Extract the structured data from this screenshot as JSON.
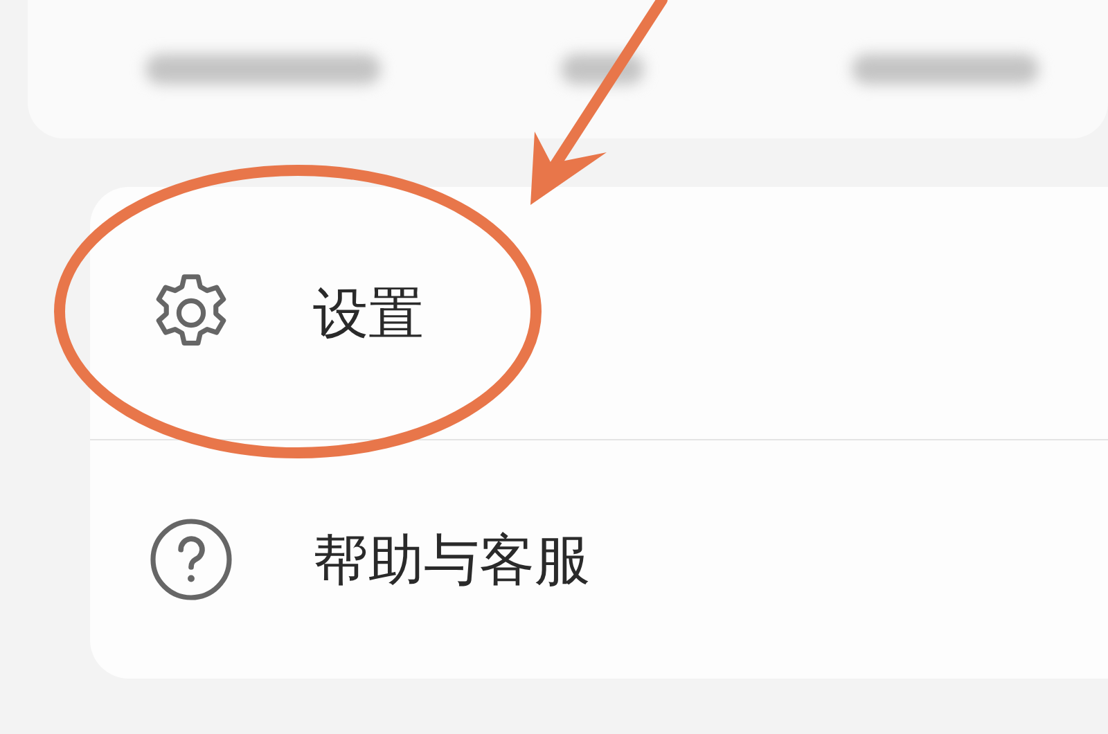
{
  "menu": {
    "items": [
      {
        "label": "设置",
        "kind": "settings",
        "highlighted": true
      },
      {
        "label": "帮助与客服",
        "kind": "help",
        "highlighted": false
      }
    ]
  }
}
